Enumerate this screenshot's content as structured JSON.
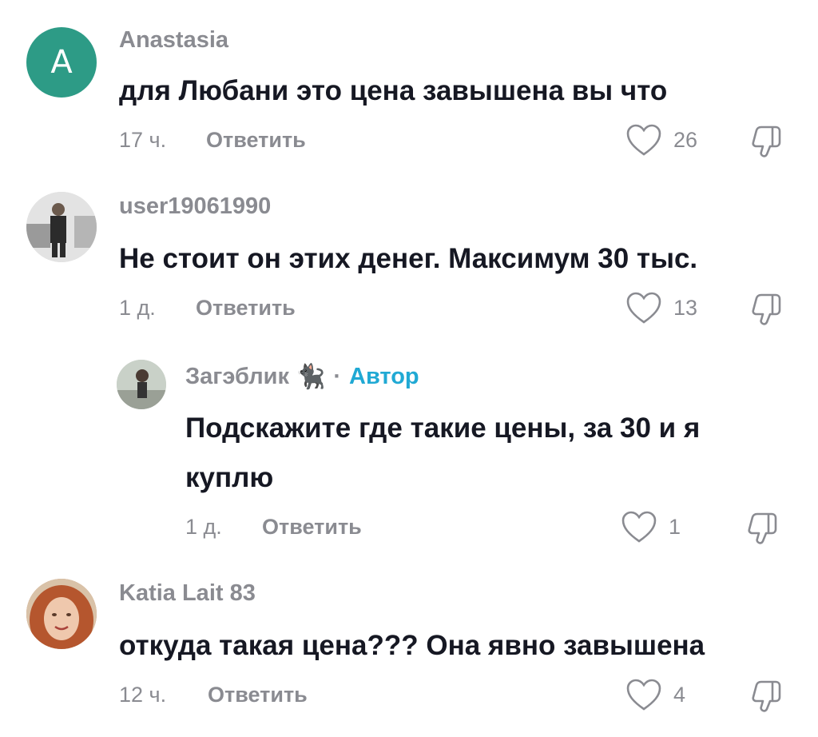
{
  "colors": {
    "avatar_a": "#2d9b86",
    "author": "#20a9d4",
    "muted": "#8a8b91",
    "text": "#161823"
  },
  "comments": [
    {
      "avatar_letter": "A",
      "username": "Anastasia",
      "text": "для Любани это цена завышена вы что",
      "time": "17 ч.",
      "reply": "Ответить",
      "likes": "26"
    },
    {
      "username": "user19061990",
      "text": "Не стоит он этих денег. Максимум 30 тыс.",
      "time": "1 д.",
      "reply": "Ответить",
      "likes": "13"
    },
    {
      "username": "Загэблик",
      "emoji": "🐈‍⬛",
      "separator": "·",
      "author_label": "Автор",
      "text_line1": "Подскажите где такие цены, за 30 и я",
      "text_line2": "куплю",
      "time": "1 д.",
      "reply": "Ответить",
      "likes": "1"
    },
    {
      "username": "Katia Lait 83",
      "text": "откуда такая цена??? Она явно завышена",
      "time": "12 ч.",
      "reply": "Ответить",
      "likes": "4"
    }
  ]
}
